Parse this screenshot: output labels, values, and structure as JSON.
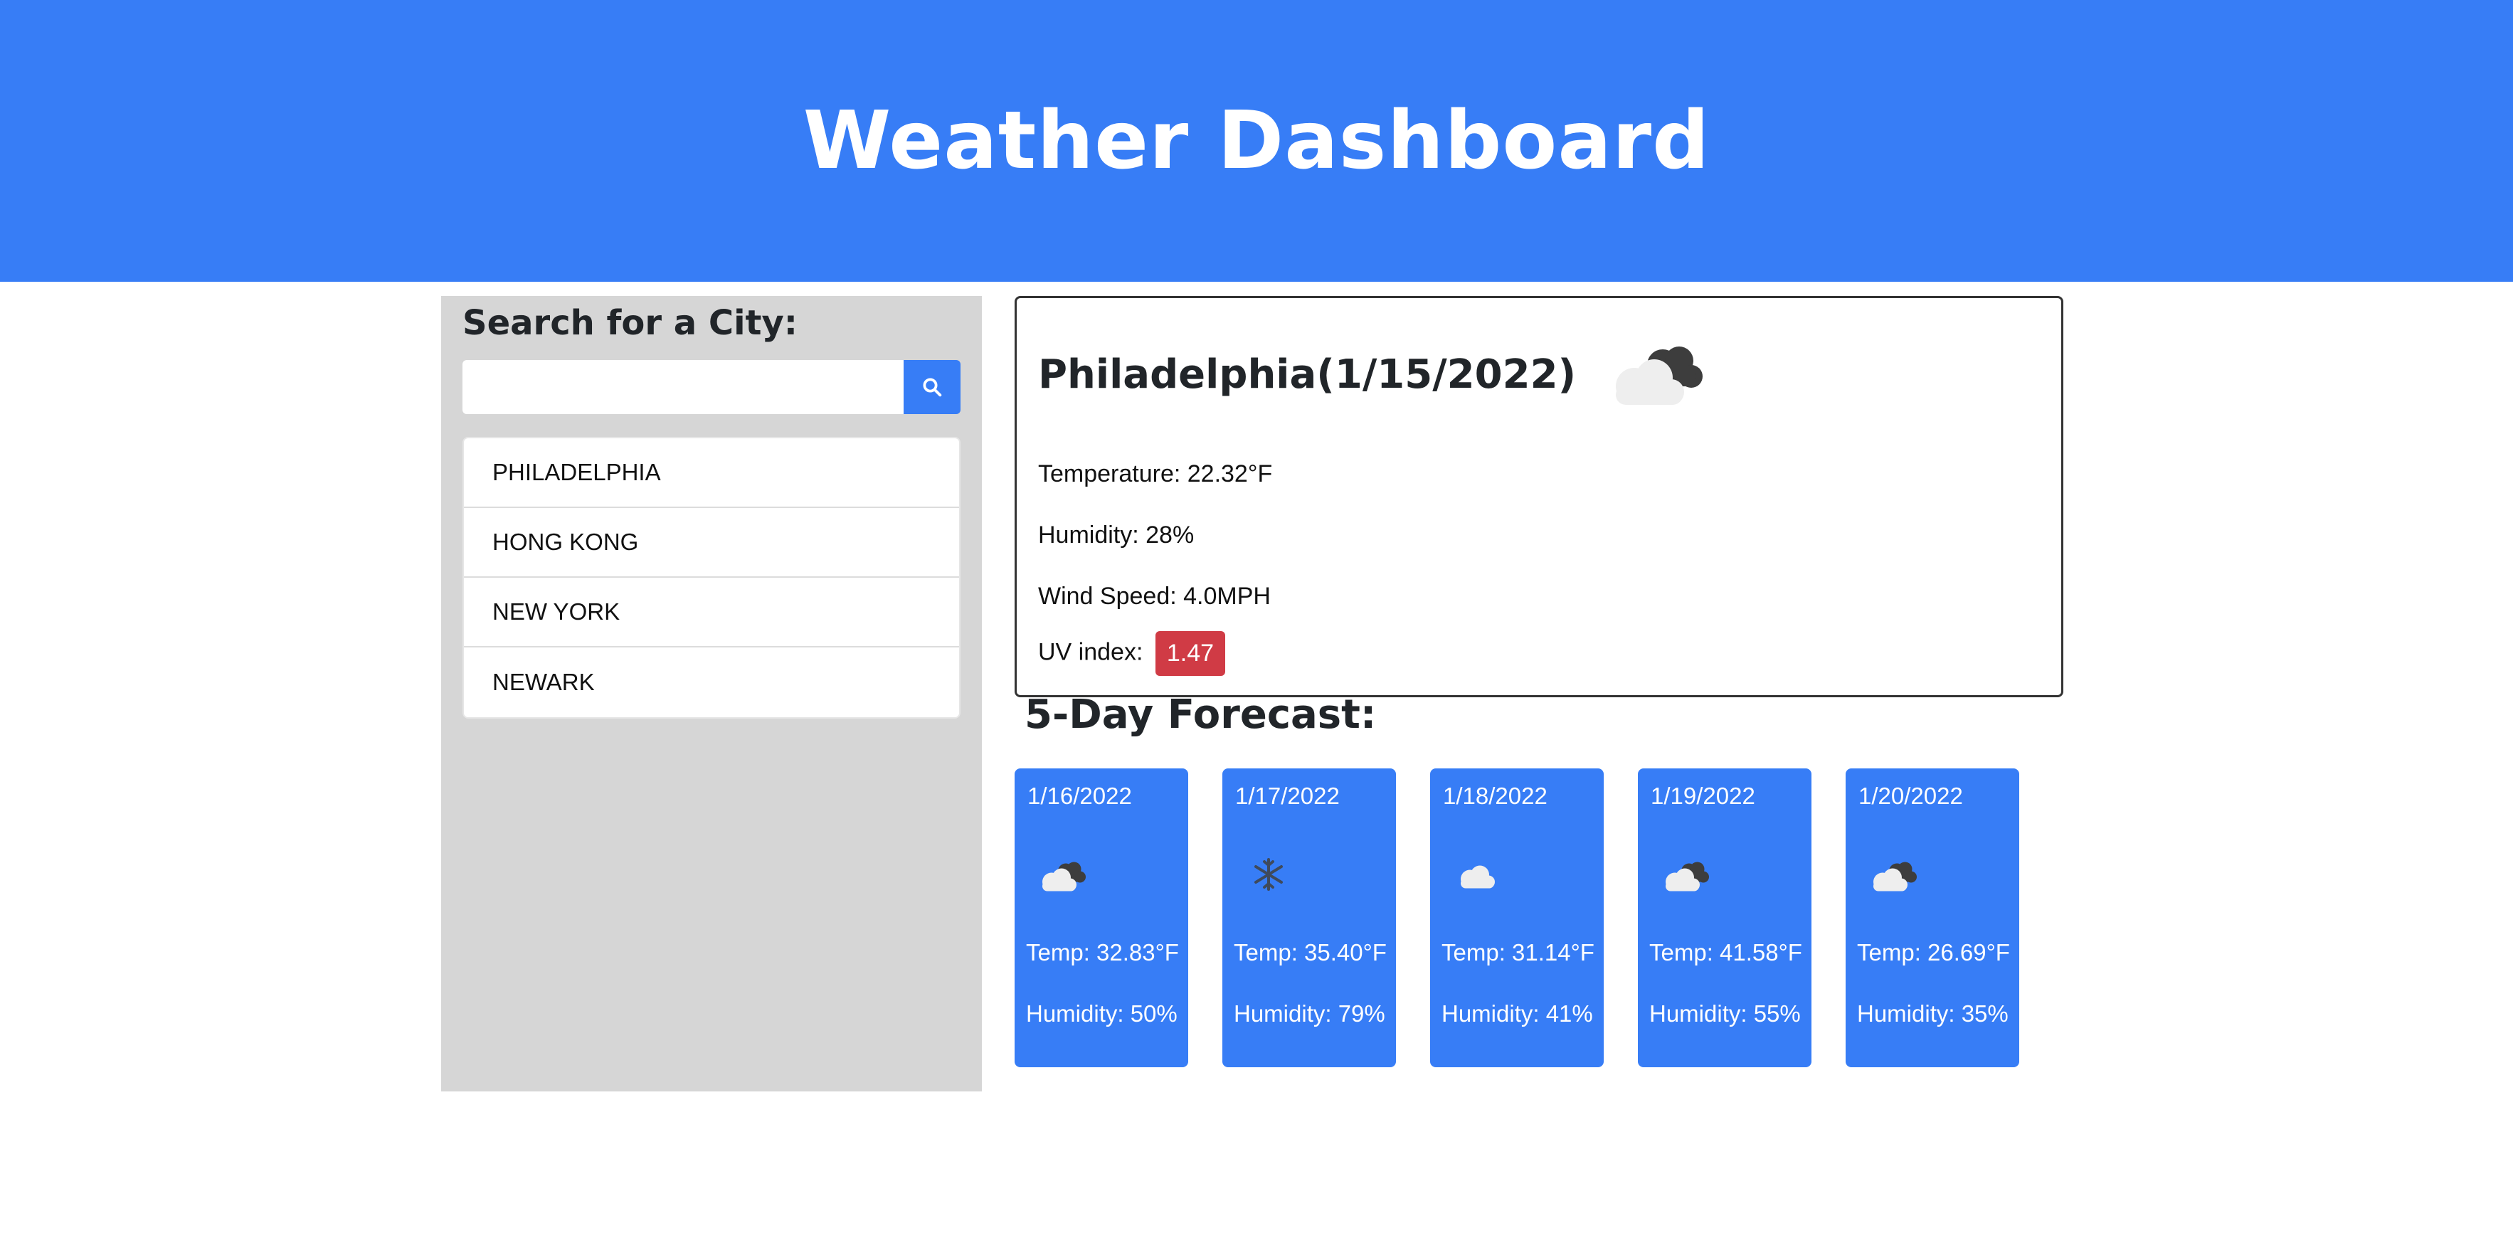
{
  "header": {
    "title": "Weather Dashboard"
  },
  "sidebar": {
    "heading": "Search for a City:",
    "search": {
      "placeholder": "",
      "value": ""
    },
    "search_button_icon": "search-icon",
    "cities": [
      {
        "label": "PHILADELPHIA"
      },
      {
        "label": "HONG KONG"
      },
      {
        "label": "NEW YORK"
      },
      {
        "label": "NEWARK"
      }
    ]
  },
  "current": {
    "title": "Philadelphia(1/15/2022)",
    "icon": "broken-clouds-icon",
    "temperature": "Temperature: 22.32°F",
    "humidity": "Humidity: 28%",
    "wind": "Wind Speed: 4.0MPH",
    "uv_label": "UV index:",
    "uv_value": "1.47",
    "uv_color": "#d03b45"
  },
  "forecast": {
    "heading": "5-Day Forecast:",
    "cards": [
      {
        "date": "1/16/2022",
        "icon": "broken-clouds-icon",
        "temp": "Temp: 32.83°F",
        "humidity": "Humidity: 50%"
      },
      {
        "date": "1/17/2022",
        "icon": "snow-icon",
        "temp": "Temp: 35.40°F",
        "humidity": "Humidity: 79%"
      },
      {
        "date": "1/18/2022",
        "icon": "cloud-icon",
        "temp": "Temp: 31.14°F",
        "humidity": "Humidity: 41%"
      },
      {
        "date": "1/19/2022",
        "icon": "broken-clouds-icon",
        "temp": "Temp: 41.58°F",
        "humidity": "Humidity: 55%"
      },
      {
        "date": "1/20/2022",
        "icon": "broken-clouds-icon",
        "temp": "Temp: 26.69°F",
        "humidity": "Humidity: 35%"
      }
    ]
  },
  "colors": {
    "accent": "#377df6",
    "sidebar_bg": "#d6d6d6",
    "uv_badge": "#d03b45"
  }
}
